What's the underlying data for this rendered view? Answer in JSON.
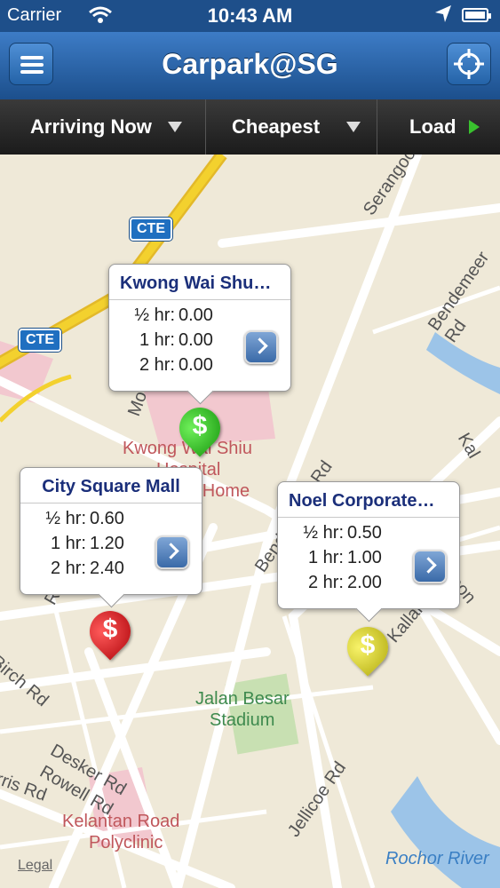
{
  "status": {
    "carrier": "Carrier",
    "time": "10:43 AM"
  },
  "nav": {
    "title": "Carpark@SG"
  },
  "toolbar": {
    "arriving": "Arriving Now",
    "sort": "Cheapest",
    "load": "Load"
  },
  "callouts": [
    {
      "title": "Kwong Wai Shu…",
      "rows": [
        {
          "label": "½ hr:",
          "value": "0.00"
        },
        {
          "label": "1 hr:",
          "value": "0.00"
        },
        {
          "label": "2 hr:",
          "value": "0.00"
        }
      ]
    },
    {
      "title": "City Square Mall",
      "rows": [
        {
          "label": "½ hr:",
          "value": "0.60"
        },
        {
          "label": "1 hr:",
          "value": "1.20"
        },
        {
          "label": "2 hr:",
          "value": "2.40"
        }
      ]
    },
    {
      "title": "Noel Corporate…",
      "rows": [
        {
          "label": "½ hr:",
          "value": "0.50"
        },
        {
          "label": "1 hr:",
          "value": "1.00"
        },
        {
          "label": "2 hr:",
          "value": "2.00"
        }
      ]
    }
  ],
  "pins": [
    {
      "symbol": "$",
      "color": "#2fbf1e"
    },
    {
      "symbol": "$",
      "color": "#d4141a"
    },
    {
      "symbol": "$",
      "color": "#d8d41a"
    }
  ],
  "map_labels": {
    "serangoon": "Serangoon Rd",
    "bendemeer": "Bendemeer Rd",
    "kwong_hospital_1": "Kwong Wai Shiu",
    "kwong_hospital_2": "Hospital",
    "kwong_hospital_3": "ng Home",
    "stadium_1": "Jalan Besar",
    "stadium_2": "Stadium",
    "desker": "Desker Rd",
    "rowell": "Rowell Rd",
    "birch": "Birch Rd",
    "farris": "rris Rd",
    "jellicoe": "Jellicoe Rd",
    "kelantan_1": "Kelantan Road",
    "kelantan_2": "Polyclinic",
    "rochor": "Rochor River",
    "kallang": "Kallang",
    "boon": "Boon R",
    "bend_lower": "Bende",
    "rd_label": "Rd",
    "kal": "Kal",
    "mo": "Mo",
    "ra": "Ra",
    "cte1": "CTE",
    "cte2": "CTE",
    "legal": "Legal"
  },
  "colors": {
    "nav_blue": "#1e4f8a",
    "map_bg": "#efe9d8",
    "road": "#ffffff",
    "expressway": "#f3d12e",
    "park": "#c8e0b2",
    "hospital": "#f2c8cf",
    "water": "#9cc4e8"
  }
}
